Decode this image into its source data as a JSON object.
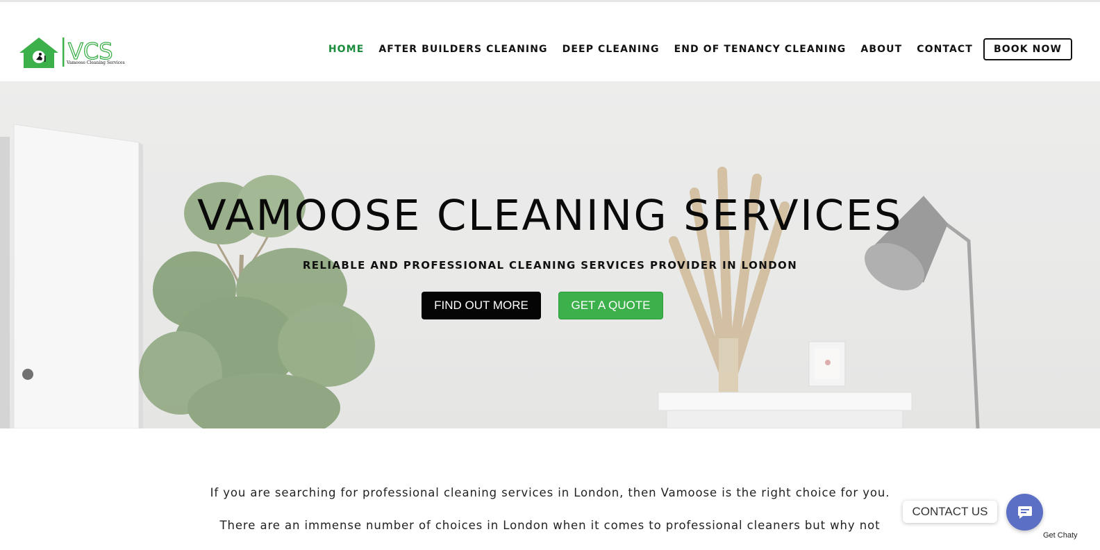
{
  "header": {
    "logo_letters": "VCS",
    "logo_subtitle": "Vamoose Cleaning Services",
    "nav": [
      {
        "label": "HOME",
        "active": true
      },
      {
        "label": "AFTER BUILDERS CLEANING",
        "active": false
      },
      {
        "label": "DEEP CLEANING",
        "active": false
      },
      {
        "label": "END OF TENANCY CLEANING",
        "active": false
      },
      {
        "label": "ABOUT",
        "active": false
      },
      {
        "label": "CONTACT",
        "active": false
      }
    ],
    "book_button": "BOOK NOW"
  },
  "hero": {
    "title": "VAMOOSE CLEANING SERVICES",
    "subtitle": "RELIABLE AND PROFESSIONAL CLEANING SERVICES PROVIDER IN LONDON",
    "primary_button": "FIND OUT MORE",
    "secondary_button": "GET A QUOTE"
  },
  "content": {
    "paragraph_1": "If you are searching for professional cleaning services in London, then Vamoose is the right choice for you.",
    "paragraph_2": "There are an immense number of choices in London when it comes to professional cleaners but why not"
  },
  "chat_widget": {
    "label": "CONTACT US",
    "credit": "Get Chaty"
  },
  "colors": {
    "brand_green": "#3cb04a",
    "active_nav": "#1a8c3c",
    "chat_blue": "#5b6fc4"
  }
}
